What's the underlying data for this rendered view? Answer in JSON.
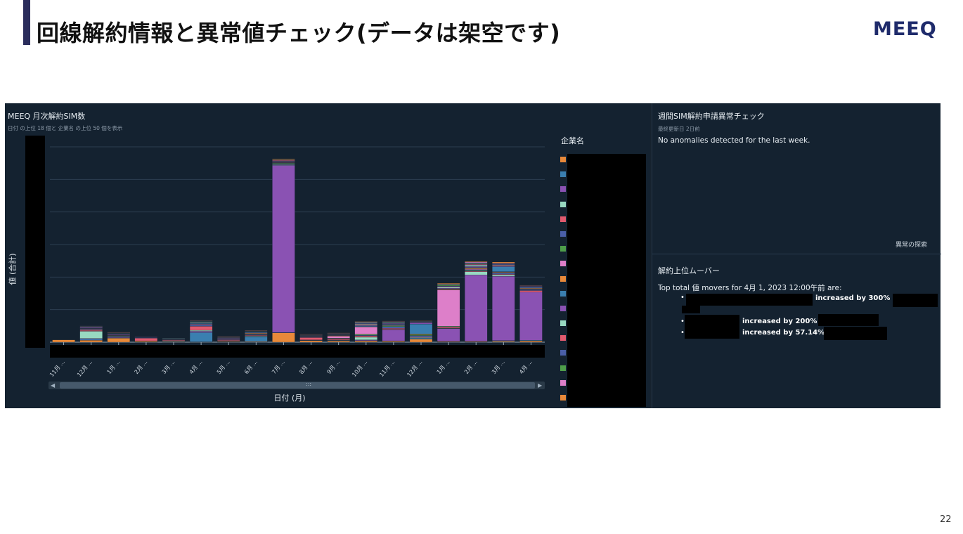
{
  "slide": {
    "title": "回線解約情報と異常値チェック(データは架空です)",
    "logo": "MEEQ",
    "page_number": "22"
  },
  "chart_panel": {
    "title": "MEEQ 月次解約SIM数",
    "subtitle": "日付 の上位 18 個と 企業名 の上位 50 個を表示",
    "legend_title": "企業名",
    "x_axis_title": "日付 (月)",
    "y_axis_title": "値 (合計)",
    "scroll_grip": ":::"
  },
  "chart_data": {
    "type": "bar",
    "stacked": true,
    "categories": [
      "11月 ...",
      "12月 ...",
      "1月 ...",
      "2月 ...",
      "3月 ...",
      "4月 ...",
      "5月 ...",
      "6月 ...",
      "7月 ...",
      "8月 ...",
      "9月 ...",
      "10月 ...",
      "11月 ...",
      "12月 ...",
      "1月 ...",
      "2月 ...",
      "3月 ...",
      "4月 ..."
    ],
    "series": [
      {
        "color": "#e8893a",
        "values": [
          7,
          6,
          12,
          3,
          2,
          1,
          2,
          2,
          28,
          5,
          4,
          4,
          3,
          9,
          2,
          2,
          3,
          4
        ]
      },
      {
        "color": "#3a7fb0",
        "values": [
          0,
          3,
          1,
          1,
          2,
          28,
          1,
          14,
          1,
          1,
          1,
          1,
          1,
          3,
          1,
          1,
          2,
          2
        ]
      },
      {
        "color": "#8a52b3",
        "values": [
          0,
          2,
          2,
          0,
          0,
          4,
          1,
          1,
          505,
          1,
          1,
          2,
          34,
          0,
          38,
          200,
          194,
          145
        ]
      },
      {
        "color": "#98d9c1",
        "values": [
          0,
          22,
          2,
          0,
          1,
          3,
          1,
          2,
          2,
          0,
          1,
          8,
          1,
          2,
          1,
          10,
          4,
          0
        ]
      },
      {
        "color": "#e05a6e",
        "values": [
          0,
          3,
          1,
          8,
          2,
          12,
          2,
          2,
          1,
          7,
          3,
          4,
          3,
          2,
          3,
          2,
          2,
          5
        ]
      },
      {
        "color": "#4a5fa8",
        "values": [
          0,
          1,
          1,
          1,
          1,
          4,
          1,
          2,
          2,
          1,
          1,
          2,
          5,
          4,
          1,
          2,
          4,
          3
        ]
      },
      {
        "color": "#4e9e4a",
        "values": [
          0,
          1,
          0,
          0,
          0,
          1,
          0,
          1,
          2,
          0,
          1,
          3,
          3,
          3,
          2,
          2,
          1,
          1
        ]
      },
      {
        "color": "#dd7fc9",
        "values": [
          0,
          2,
          1,
          0,
          0,
          2,
          2,
          1,
          1,
          1,
          6,
          22,
          2,
          0,
          110,
          2,
          1,
          1
        ]
      },
      {
        "color": "#e8893a",
        "values": [
          0,
          1,
          1,
          0,
          1,
          1,
          1,
          2,
          1,
          1,
          2,
          1,
          1,
          2,
          2,
          3,
          2,
          2
        ]
      },
      {
        "color": "#3a7fb0",
        "values": [
          0,
          1,
          1,
          1,
          1,
          2,
          1,
          2,
          1,
          1,
          1,
          2,
          2,
          30,
          1,
          2,
          15,
          2
        ]
      },
      {
        "color": "#8a52b3",
        "values": [
          0,
          2,
          2,
          1,
          1,
          1,
          1,
          1,
          2,
          1,
          1,
          2,
          2,
          4,
          2,
          3,
          2,
          2
        ]
      },
      {
        "color": "#98d9c1",
        "values": [
          0,
          1,
          1,
          0,
          1,
          2,
          1,
          1,
          1,
          1,
          1,
          3,
          2,
          1,
          3,
          4,
          2,
          1
        ]
      },
      {
        "color": "#e05a6e",
        "values": [
          0,
          1,
          1,
          1,
          0,
          1,
          1,
          1,
          2,
          1,
          1,
          2,
          1,
          1,
          2,
          2,
          2,
          1
        ]
      },
      {
        "color": "#4a5fa8",
        "values": [
          0,
          1,
          1,
          1,
          0,
          1,
          1,
          1,
          1,
          1,
          1,
          2,
          1,
          1,
          2,
          2,
          2,
          1
        ]
      },
      {
        "color": "#4e9e4a",
        "values": [
          0,
          1,
          1,
          0,
          0,
          1,
          0,
          1,
          1,
          0,
          1,
          2,
          1,
          1,
          4,
          2,
          1,
          0
        ]
      },
      {
        "color": "#dd7fc9",
        "values": [
          0,
          1,
          1,
          0,
          0,
          1,
          1,
          1,
          1,
          1,
          1,
          2,
          1,
          1,
          2,
          3,
          2,
          1
        ]
      },
      {
        "color": "#e8893a",
        "values": [
          0,
          0,
          1,
          0,
          0,
          1,
          1,
          1,
          2,
          1,
          1,
          1,
          1,
          1,
          2,
          2,
          3,
          1
        ]
      }
    ],
    "ylim": [
      0,
      590
    ],
    "grid": true,
    "legend_placement": "right"
  },
  "legend_colors": [
    "#e8893a",
    "#3a7fb0",
    "#8a52b3",
    "#98d9c1",
    "#e05a6e",
    "#4a5fa8",
    "#4e9e4a",
    "#dd7fc9",
    "#e8893a",
    "#3a7fb0",
    "#8a52b3",
    "#98d9c1",
    "#e05a6e",
    "#4a5fa8",
    "#4e9e4a",
    "#dd7fc9",
    "#e8893a"
  ],
  "anomaly_panel": {
    "title": "週間SIM解約申請異常チェック",
    "updated": "最終更新日 2日前",
    "message": "No anomalies detected for the last week.",
    "explore_link": "異常の探索"
  },
  "movers_panel": {
    "title": "解約上位ムーバー",
    "intro": "Top total 値 movers for 4月 1, 2023 12:00午前 are:",
    "items": [
      {
        "change": "increased by 300%"
      },
      {
        "change": "increased by 200%"
      },
      {
        "change": "increased by 57.14%"
      }
    ]
  },
  "icons": {
    "bullet": "•",
    "scroll_left": "◀",
    "scroll_right": "▶"
  }
}
